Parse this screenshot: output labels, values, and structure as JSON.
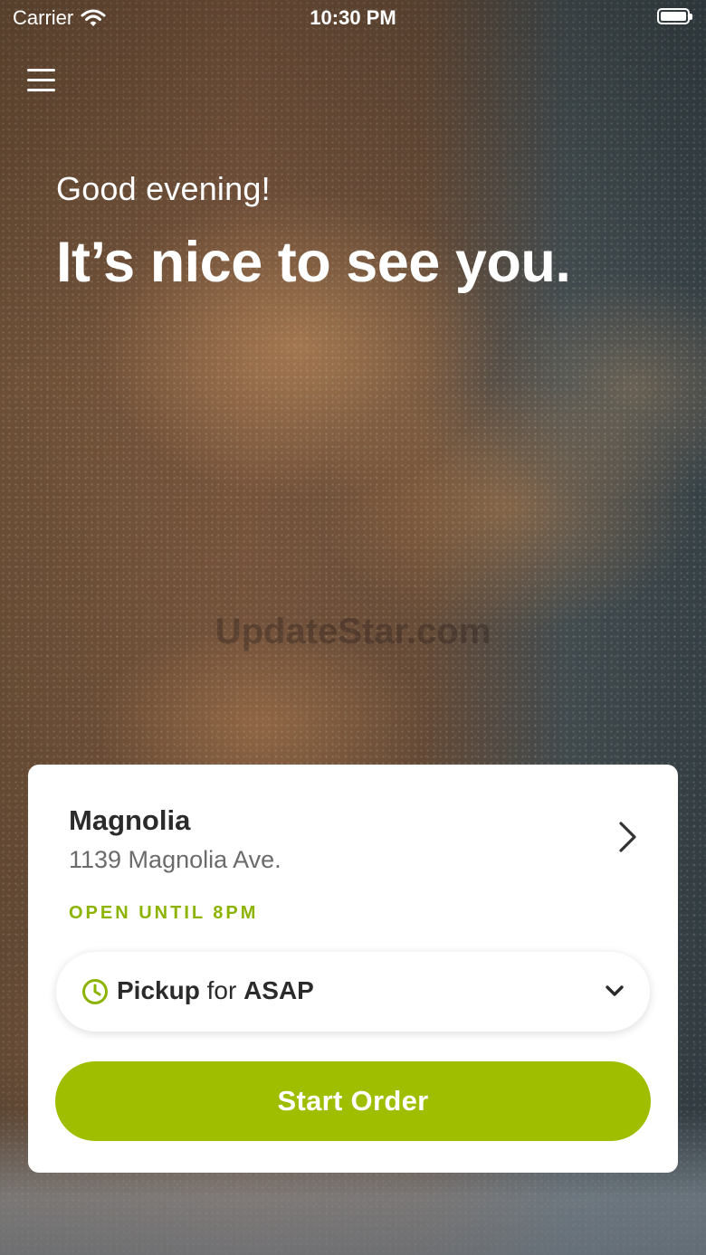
{
  "status_bar": {
    "carrier": "Carrier",
    "time": "10:30 PM"
  },
  "hero": {
    "greeting": "Good evening!",
    "headline": "It’s nice to see you.",
    "watermark": "UpdateStar.com"
  },
  "location": {
    "name": "Magnolia",
    "address": "1139 Magnolia Ave.",
    "status": "OPEN UNTIL 8PM"
  },
  "order_type": {
    "mode": "Pickup",
    "connector": "for",
    "time": "ASAP"
  },
  "actions": {
    "start_order": "Start Order"
  },
  "colors": {
    "accent": "#a0be00",
    "status_open": "#8cb300"
  },
  "icons": {
    "menu": "menu-icon",
    "location_chevron": "chevron-right-icon",
    "clock": "clock-icon",
    "dropdown": "chevron-down-icon"
  }
}
